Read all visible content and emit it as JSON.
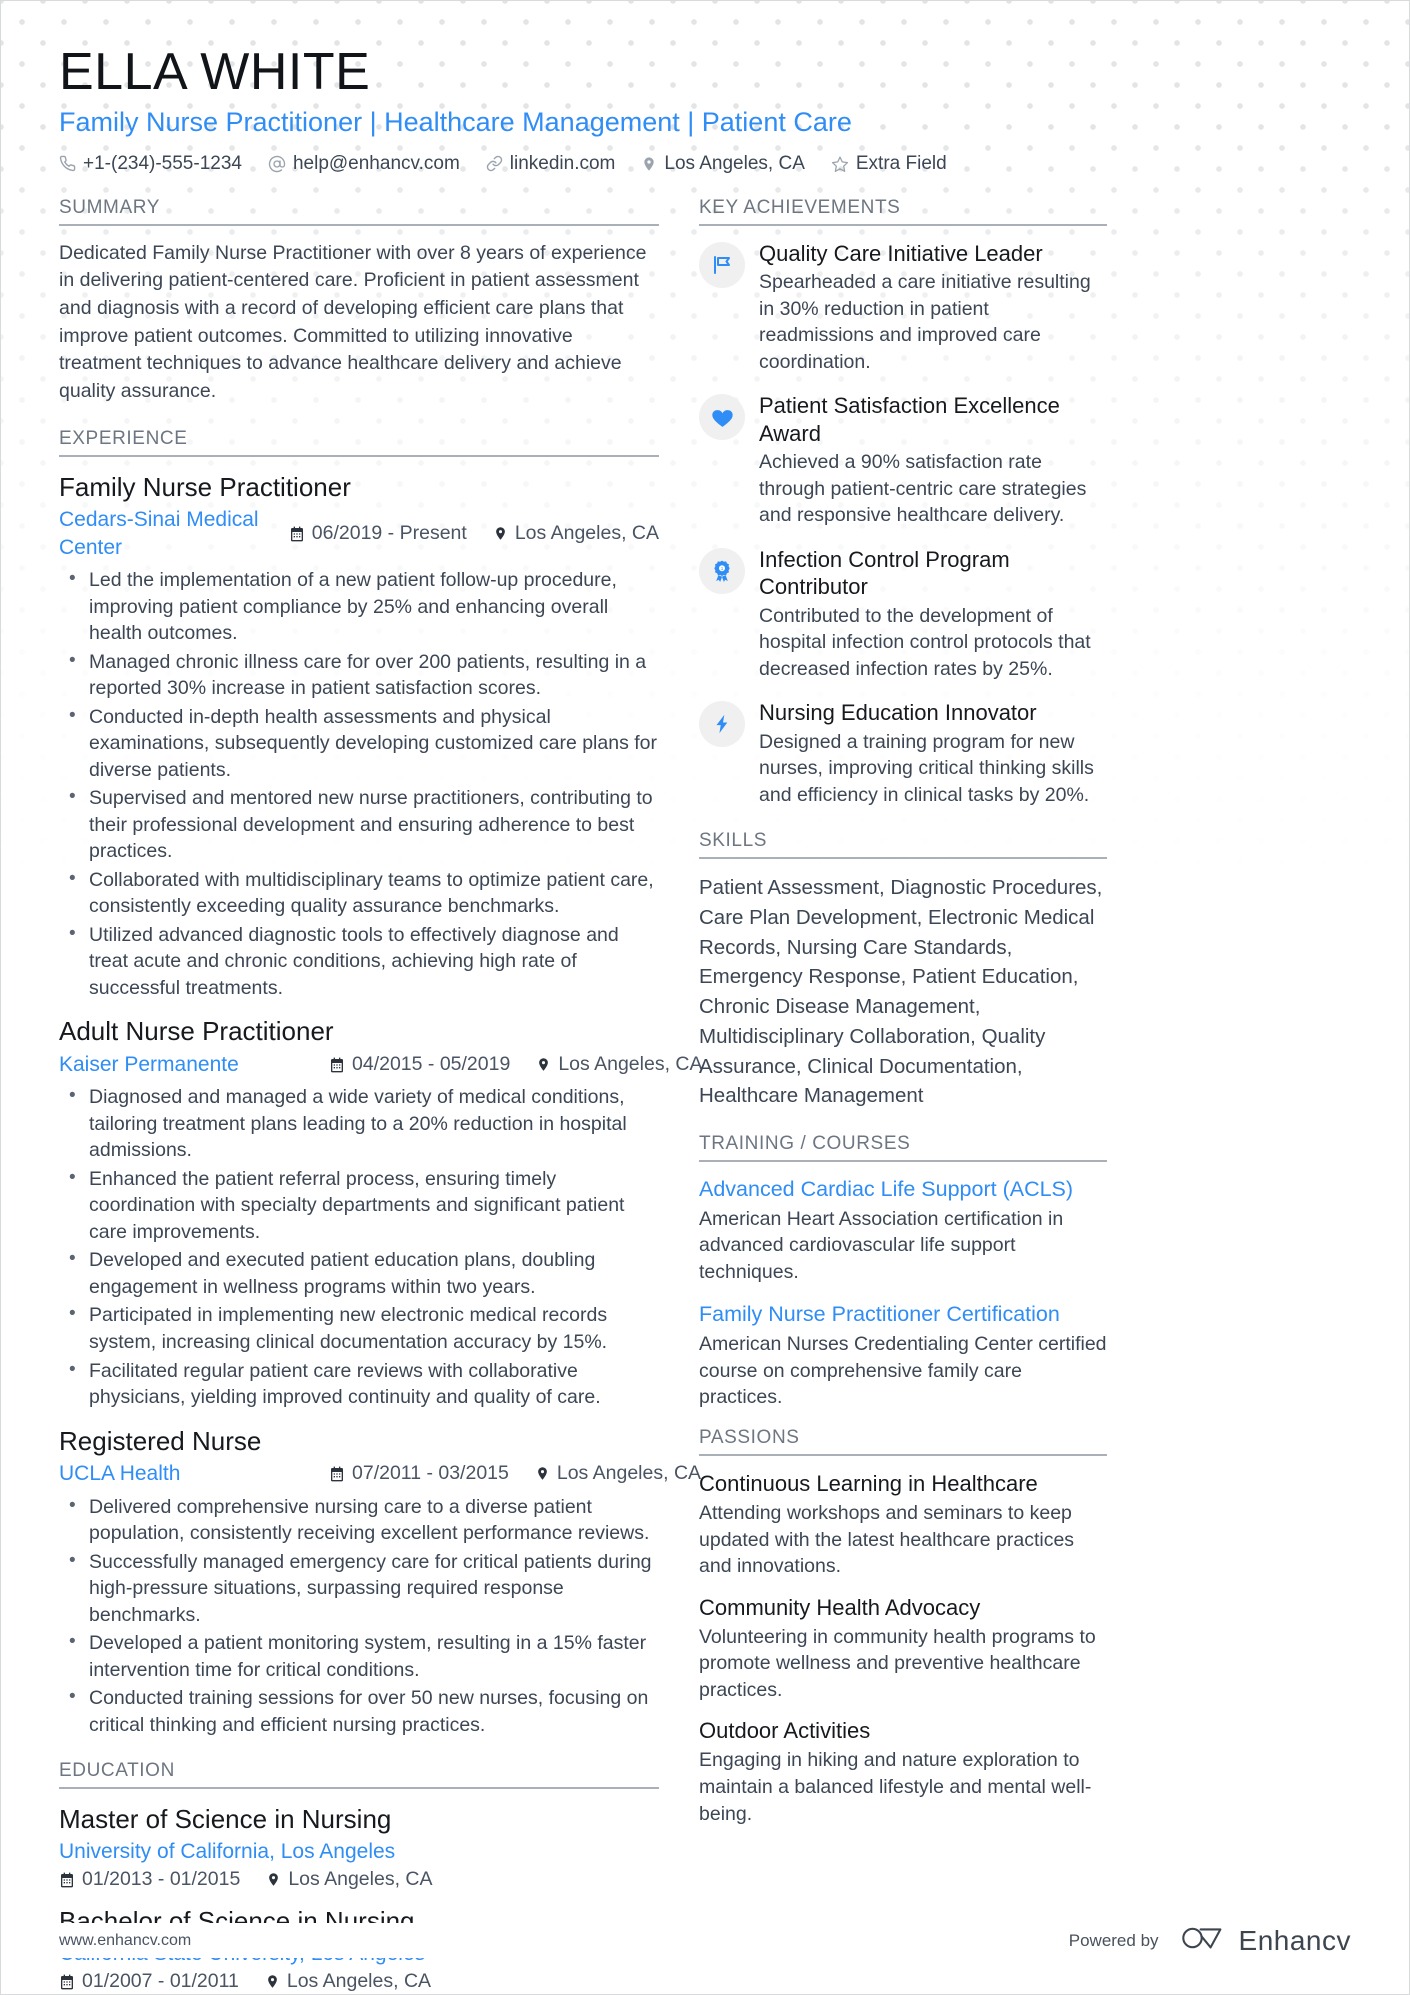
{
  "header": {
    "name": "ELLA WHITE",
    "headline": "Family Nurse Practitioner | Healthcare Management | Patient Care",
    "contacts": [
      {
        "icon": "phone-icon",
        "text": "+1-(234)-555-1234"
      },
      {
        "icon": "email-icon",
        "text": "help@enhancv.com"
      },
      {
        "icon": "link-icon",
        "text": "linkedin.com"
      },
      {
        "icon": "location-pin-icon",
        "text": "Los Angeles, CA"
      },
      {
        "icon": "star-icon",
        "text": "Extra Field"
      }
    ]
  },
  "left": {
    "summary": {
      "title": "SUMMARY",
      "text": "Dedicated Family Nurse Practitioner with over 8 years of experience in delivering patient-centered care. Proficient in patient assessment and diagnosis with a record of developing efficient care plans that improve patient outcomes. Committed to utilizing innovative treatment techniques to advance healthcare delivery and achieve quality assurance."
    },
    "experience": {
      "title": "EXPERIENCE",
      "jobs": [
        {
          "title": "Family Nurse Practitioner",
          "org": "Cedars-Sinai Medical Center",
          "dates": "06/2019 - Present",
          "location": "Los Angeles, CA",
          "bullets": [
            "Led the implementation of a new patient follow-up procedure, improving patient compliance by 25% and enhancing overall health outcomes.",
            "Managed chronic illness care for over 200 patients, resulting in a reported 30% increase in patient satisfaction scores.",
            "Conducted in-depth health assessments and physical examinations, subsequently developing customized care plans for diverse patients.",
            "Supervised and mentored new nurse practitioners, contributing to their professional development and ensuring adherence to best practices.",
            "Collaborated with multidisciplinary teams to optimize patient care, consistently exceeding quality assurance benchmarks.",
            "Utilized advanced diagnostic tools to effectively diagnose and treat acute and chronic conditions, achieving high rate of successful treatments."
          ]
        },
        {
          "title": "Adult Nurse Practitioner",
          "org": "Kaiser Permanente",
          "dates": "04/2015 - 05/2019",
          "location": "Los Angeles, CA",
          "bullets": [
            "Diagnosed and managed a wide variety of medical conditions, tailoring treatment plans leading to a 20% reduction in hospital admissions.",
            "Enhanced the patient referral process, ensuring timely coordination with specialty departments and significant patient care improvements.",
            "Developed and executed patient education plans, doubling engagement in wellness programs within two years.",
            "Participated in implementing new electronic medical records system, increasing clinical documentation accuracy by 15%.",
            "Facilitated regular patient care reviews with collaborative physicians, yielding improved continuity and quality of care."
          ]
        },
        {
          "title": "Registered Nurse",
          "org": "UCLA Health",
          "dates": "07/2011 - 03/2015",
          "location": "Los Angeles, CA",
          "bullets": [
            "Delivered comprehensive nursing care to a diverse patient population, consistently receiving excellent performance reviews.",
            "Successfully managed emergency care for critical patients during high-pressure situations, surpassing required response benchmarks.",
            "Developed a patient monitoring system, resulting in a 15% faster intervention time for critical conditions.",
            "Conducted training sessions for over 50 new nurses, focusing on critical thinking and efficient nursing practices."
          ]
        }
      ]
    },
    "education": {
      "title": "EDUCATION",
      "items": [
        {
          "degree": "Master of Science in Nursing",
          "school": "University of California, Los Angeles",
          "dates": "01/2013 - 01/2015",
          "location": "Los Angeles, CA"
        },
        {
          "degree": "Bachelor of Science in Nursing",
          "school": "California State University, Los Angeles",
          "dates": "01/2007 - 01/2011",
          "location": "Los Angeles, CA"
        }
      ]
    }
  },
  "right": {
    "achievements": {
      "title": "KEY ACHIEVEMENTS",
      "items": [
        {
          "icon": "flag-icon",
          "title": "Quality Care Initiative Leader",
          "desc": "Spearheaded a care initiative resulting in 30% reduction in patient readmissions and improved care coordination."
        },
        {
          "icon": "heart-icon",
          "title": "Patient Satisfaction Excellence Award",
          "desc": "Achieved a 90% satisfaction rate through patient-centric care strategies and responsive healthcare delivery."
        },
        {
          "icon": "award-ribbon-icon",
          "title": "Infection Control Program Contributor",
          "desc": "Contributed to the development of hospital infection control protocols that decreased infection rates by 25%."
        },
        {
          "icon": "lightning-bolt-icon",
          "title": "Nursing Education Innovator",
          "desc": "Designed a training program for new nurses, improving critical thinking skills and efficiency in clinical tasks by 20%."
        }
      ]
    },
    "skills": {
      "title": "SKILLS",
      "text": "Patient Assessment, Diagnostic Procedures, Care Plan Development, Electronic Medical Records, Nursing Care Standards, Emergency Response, Patient Education, Chronic Disease Management, Multidisciplinary Collaboration, Quality Assurance, Clinical Documentation, Healthcare Management"
    },
    "training": {
      "title": "TRAINING / COURSES",
      "items": [
        {
          "title": "Advanced Cardiac Life Support (ACLS)",
          "desc": "American Heart Association certification in advanced cardiovascular life support techniques."
        },
        {
          "title": "Family Nurse Practitioner Certification",
          "desc": "American Nurses Credentialing Center certified course on comprehensive family care practices."
        }
      ]
    },
    "passions": {
      "title": "PASSIONS",
      "items": [
        {
          "title": "Continuous Learning in Healthcare",
          "desc": "Attending workshops and seminars to keep updated with the latest healthcare practices and innovations."
        },
        {
          "title": "Community Health Advocacy",
          "desc": "Volunteering in community health programs to promote wellness and preventive healthcare practices."
        },
        {
          "title": "Outdoor Activities",
          "desc": "Engaging in hiking and nature exploration to maintain a balanced lifestyle and mental well-being."
        }
      ]
    }
  },
  "footer": {
    "url": "www.enhancv.com",
    "powered_by": "Powered by",
    "brand": "Enhancv"
  },
  "colors": {
    "accent_blue": "#2f8df5",
    "text_dark": "#16191d",
    "text_body": "#3c4654",
    "heading_gray": "#6d7681",
    "rule_gray": "#a9b0b8",
    "badge_bg": "#f0f0f0",
    "dot_pattern": "#e3e4e6"
  }
}
